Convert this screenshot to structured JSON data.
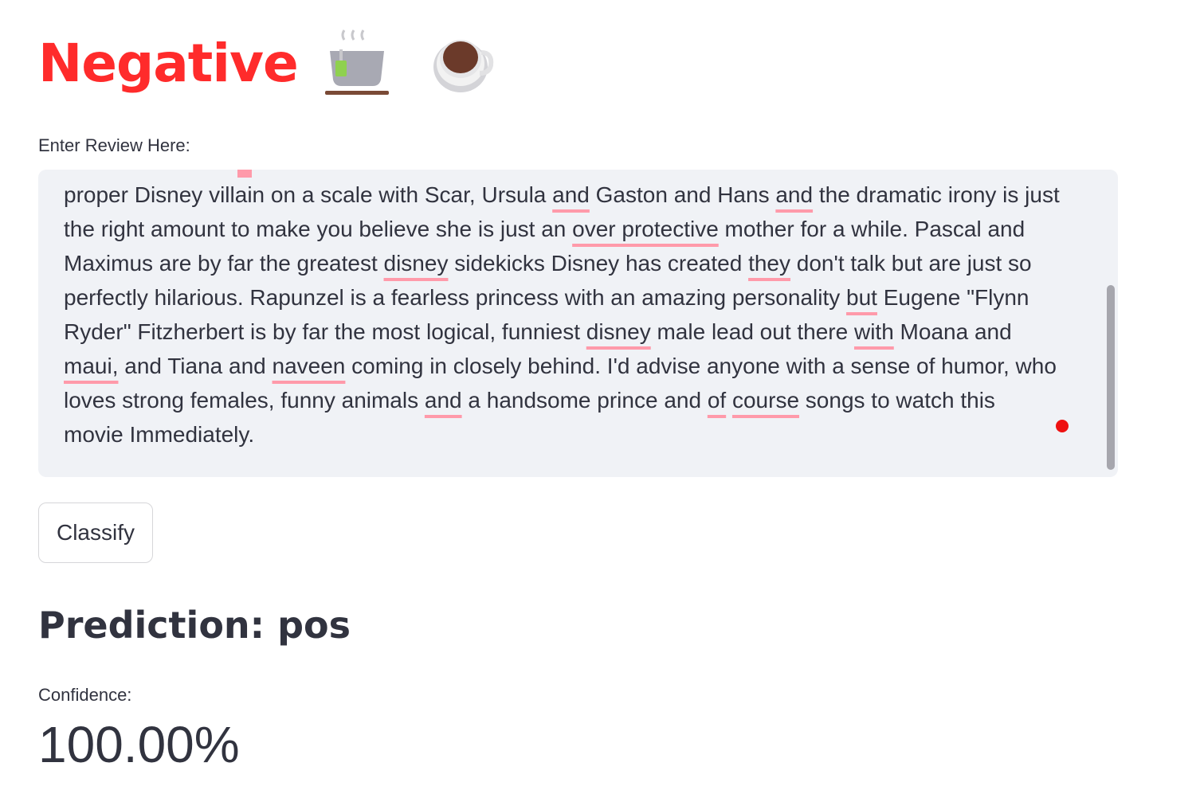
{
  "header": {
    "title": "Negative",
    "emoji_1": "tea-icon",
    "emoji_2": "coffee-icon"
  },
  "review": {
    "label": "Enter Review Here:",
    "lines": [
      [
        "proper Disney villain on a scale with Scar, Ursula ",
        {
          "u": "and"
        },
        " Gaston and Hans ",
        {
          "u": "and"
        },
        " the dramatic irony is just"
      ],
      [
        "the right amount to make you believe she is just an ",
        {
          "u": "over protective"
        },
        " mother for a while. Pascal and"
      ],
      [
        "Maximus are by far the greatest ",
        {
          "u": "disney"
        },
        " sidekicks Disney has created ",
        {
          "u": "they"
        },
        " don't talk but are just so"
      ],
      [
        "perfectly hilarious. Rapunzel is a fearless princess with an amazing personality ",
        {
          "u": "but"
        },
        " Eugene \"Flynn"
      ],
      [
        "Ryder\" Fitzherbert is by far the most logical, funniest ",
        {
          "u": "disney"
        },
        " male lead out there ",
        {
          "u": "with"
        },
        " Moana and"
      ],
      [
        {
          "u": "maui,"
        },
        " and Tiana and ",
        {
          "u": "naveen"
        },
        " coming in closely behind. I'd advise anyone with a sense of humor, who"
      ],
      [
        "loves strong females, funny animals ",
        {
          "u": "and"
        },
        " a handsome prince and ",
        {
          "u": "of"
        },
        " ",
        {
          "u": "course"
        },
        " songs to watch this"
      ],
      [
        "movie Immediately."
      ]
    ]
  },
  "classify_button": {
    "label": "Classify"
  },
  "result": {
    "prediction": "Prediction: pos",
    "confidence_label": "Confidence:",
    "confidence_value": "100.00%"
  }
}
